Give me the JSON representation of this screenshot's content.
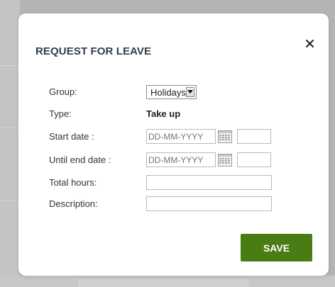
{
  "modal": {
    "title": "REQUEST FOR LEAVE",
    "close_icon": "close-icon"
  },
  "form": {
    "group": {
      "label": "Group:",
      "value": "Holidays"
    },
    "type": {
      "label": "Type:",
      "value": "Take up"
    },
    "start_date": {
      "label": "Start date :",
      "placeholder": "DD-MM-YYYY",
      "time_value": ""
    },
    "until_end_date": {
      "label": "Until end date :",
      "placeholder": "DD-MM-YYYY",
      "time_value": ""
    },
    "total_hours": {
      "label": "Total hours:",
      "value": ""
    },
    "description": {
      "label": "Description:",
      "value": ""
    }
  },
  "actions": {
    "save_label": "SAVE"
  },
  "colors": {
    "accent": "#4a7c14",
    "title": "#2f3d4f",
    "overlay": "#b4b4b4"
  }
}
